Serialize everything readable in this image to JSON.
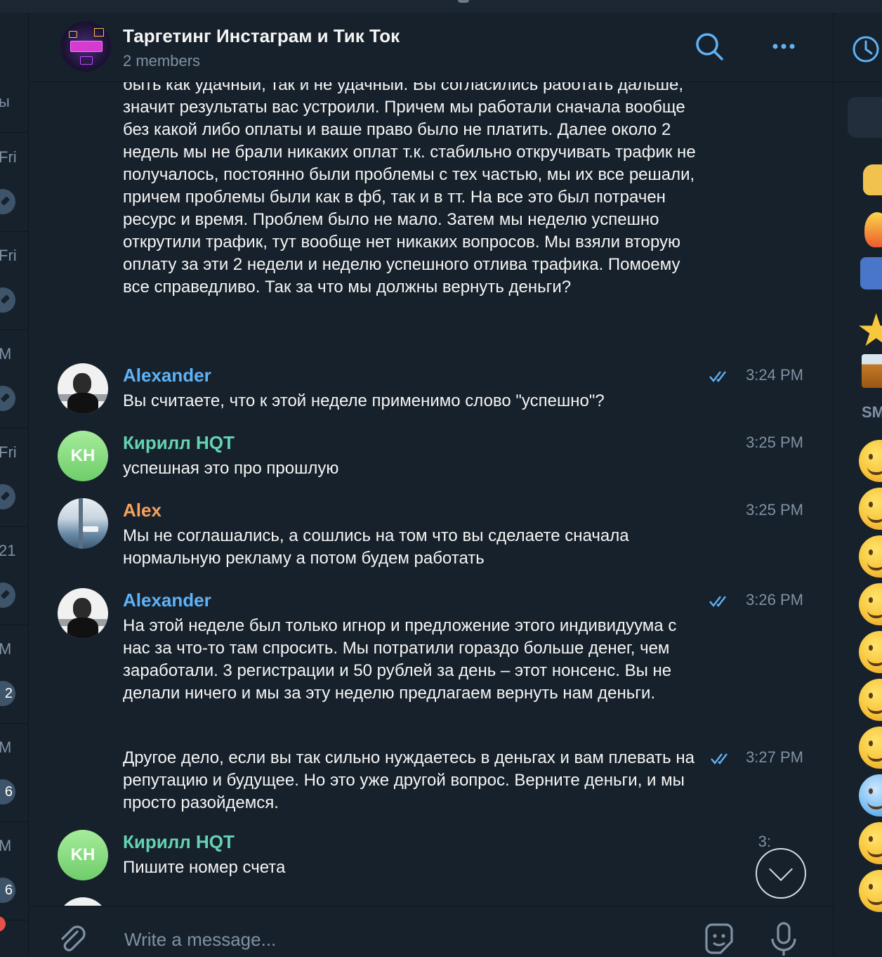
{
  "chat": {
    "title": "Таргетинг Инстаграм и Тик Ток",
    "subtitle": "2 members"
  },
  "left_list": {
    "rows": [
      {
        "text": "ы",
        "badge": ""
      },
      {
        "text": "Fri",
        "badge": ""
      },
      {
        "text": "Fri",
        "badge": ""
      },
      {
        "text": "M",
        "badge": ""
      },
      {
        "text": "Fri",
        "badge": ""
      },
      {
        "text": "21",
        "badge": ""
      },
      {
        "text": "M",
        "badge": "2"
      },
      {
        "text": "M",
        "badge": "6"
      },
      {
        "text": "M",
        "badge": "6"
      }
    ]
  },
  "messages": {
    "continued_text": "быть как удачный, так и не удачный. Вы согласились работать дальше, значит результаты вас устроили. Причем мы работали сначала вообще без какой либо оплаты и ваше право было не платить. Далее около 2 недель мы не брали никаких оплат т.к. стабильно откручивать трафик не получалось, постоянно были проблемы с тех частью, мы их все решали, причем проблемы были как в фб, так и в тт. На все это был потрачен ресурс и время. Проблем было не мало. Затем мы неделю успешно открутили трафик, тут вообще нет никаких вопросов. Мы взяли вторую оплату за эти 2 недели и неделю успешного отлива трафика. Помоему все справедливо. Так за что мы должны вернуть деньги?",
    "items": [
      {
        "name": "Alexander",
        "color": "#5fb2f6",
        "time": "3:24 PM",
        "text": "Вы считаете, что к этой неделе применимо слово \"успешно\"?"
      },
      {
        "name": "Кирилл HQT",
        "initials": "KH",
        "color": "#64d3b3",
        "time": "3:25 PM",
        "text": "успешная это про прошлую"
      },
      {
        "name": "Alex",
        "color": "#f5a25c",
        "time": "3:25 PM",
        "text": "Мы не соглашались, а сошлись на том что вы сделаете сначала нормальную рекламу а потом будем работать"
      },
      {
        "name": "Alexander",
        "color": "#5fb2f6",
        "time": "3:26 PM",
        "text": "На этой неделе был только игнор и предложение этого индивидуума с нас за что-то там спросить. Мы потратили гораздо больше денег, чем заработали. 3 регистрации и 50 рублей за день – этот нонсенс. Вы не делали ничего и мы за эту неделю предлагаем вернуть нам деньги."
      },
      {
        "time": "3:27 PM",
        "text": "Другое дело, если вы так сильно нуждаетесь в деньгах и вам плевать на репутацию и будущее. Но это уже другой вопрос. Верните деньги, и мы просто разойдемся."
      },
      {
        "name": "Кирилл HQT",
        "initials": "KH",
        "color": "#64d3b3",
        "time": "3:",
        "text": "Пишите номер счета"
      }
    ]
  },
  "composer": {
    "placeholder": "Write a message..."
  },
  "sidebar_right": {
    "section_label": "SM"
  },
  "colors": {
    "background": "#17212b",
    "accent": "#5fb2f6",
    "muted": "#7f91a4"
  }
}
